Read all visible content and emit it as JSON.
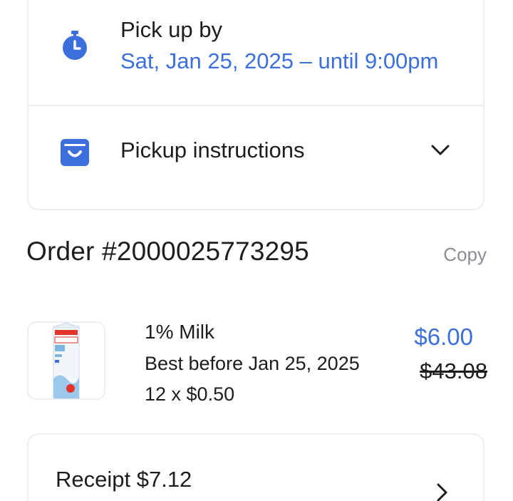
{
  "pickup": {
    "label": "Pick up by",
    "date": "Sat, Jan 25, 2025 – until 9:00pm",
    "icon": "stopwatch-icon"
  },
  "instructions": {
    "label": "Pickup instructions",
    "icon": "shopping-bag-icon",
    "expand_icon": "chevron-down-icon"
  },
  "order": {
    "title": "Order #2000025773295",
    "copy_label": "Copy"
  },
  "items": [
    {
      "name": "1% Milk",
      "best_before": "Best before Jan 25, 2025",
      "quantity": "12 x $0.50",
      "price": "$6.00",
      "original_price": "$43.08"
    }
  ],
  "receipt": {
    "label": "Receipt $7.12",
    "icon": "chevron-right-icon"
  },
  "colors": {
    "accent": "#3c6fdc",
    "text": "#1d1d1f",
    "muted": "#8a8d93",
    "border": "#eceef1"
  }
}
